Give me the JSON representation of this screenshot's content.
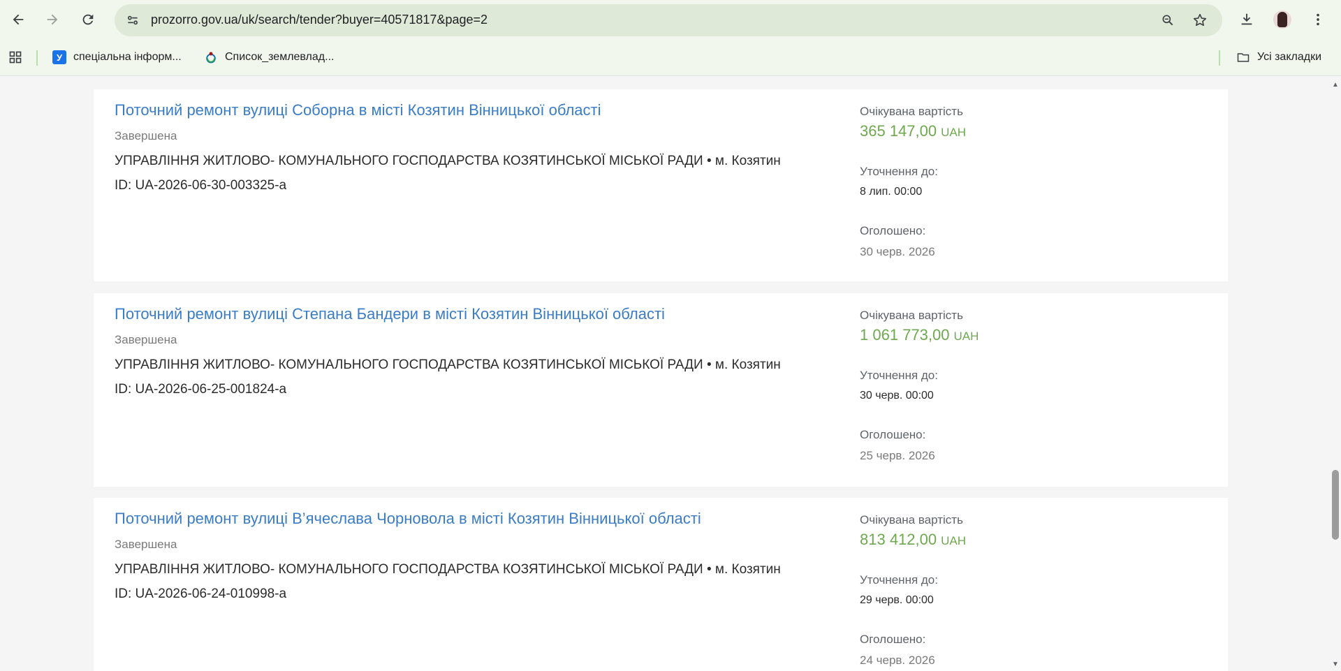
{
  "browser": {
    "url": "prozorro.gov.ua/uk/search/tender?buyer=40571817&page=2",
    "bookmarks": [
      {
        "label": "спеціальна інформ...",
        "icon": "ukr-gov-icon"
      },
      {
        "label": "Список_землевлад...",
        "icon": "wikimedia-icon"
      }
    ],
    "all_bookmarks_label": "Усі закладки"
  },
  "tenders": [
    {
      "title": "Поточний ремонт вулиці Соборна в місті Козятин Вінницької області",
      "status": "Завершена",
      "organization": "УПРАВЛІННЯ ЖИТЛОВО- КОМУНАЛЬНОГО ГОСПОДАРСТВА КОЗЯТИНСЬКОЇ МІСЬКОЇ РАДИ • м. Козятин",
      "id": "ID: UA-2026-06-30-003325-a",
      "expected_label": "Очікувана вартість",
      "amount": "365 147,00",
      "currency": "UAH",
      "clarification_label": "Уточнення до:",
      "clarification_value": "8 лип. 00:00",
      "announced_label": "Оголошено:",
      "announced_value": "30 черв. 2026"
    },
    {
      "title": "Поточний ремонт вулиці Степана Бандери в місті Козятин Вінницької області",
      "status": "Завершена",
      "organization": "УПРАВЛІННЯ ЖИТЛОВО- КОМУНАЛЬНОГО ГОСПОДАРСТВА КОЗЯТИНСЬКОЇ МІСЬКОЇ РАДИ • м. Козятин",
      "id": "ID: UA-2026-06-25-001824-a",
      "expected_label": "Очікувана вартість",
      "amount": "1 061 773,00",
      "currency": "UAH",
      "clarification_label": "Уточнення до:",
      "clarification_value": "30 черв. 00:00",
      "announced_label": "Оголошено:",
      "announced_value": "25 черв. 2026"
    },
    {
      "title": "Поточний ремонт вулиці В’ячеслава Чорновола в місті Козятин Вінницької області",
      "status": "Завершена",
      "organization": "УПРАВЛІННЯ ЖИТЛОВО- КОМУНАЛЬНОГО ГОСПОДАРСТВА КОЗЯТИНСЬКОЇ МІСЬКОЇ РАДИ • м. Козятин",
      "id": "ID: UA-2026-06-24-010998-a",
      "expected_label": "Очікувана вартість",
      "amount": "813 412,00",
      "currency": "UAH",
      "clarification_label": "Уточнення до:",
      "clarification_value": "29 черв. 00:00",
      "announced_label": "Оголошено:",
      "announced_value": "24 черв. 2026"
    }
  ],
  "colors": {
    "title_link": "#3a7cc6",
    "amount": "#6ea84f",
    "chrome_bg": "#f1f7ec"
  }
}
